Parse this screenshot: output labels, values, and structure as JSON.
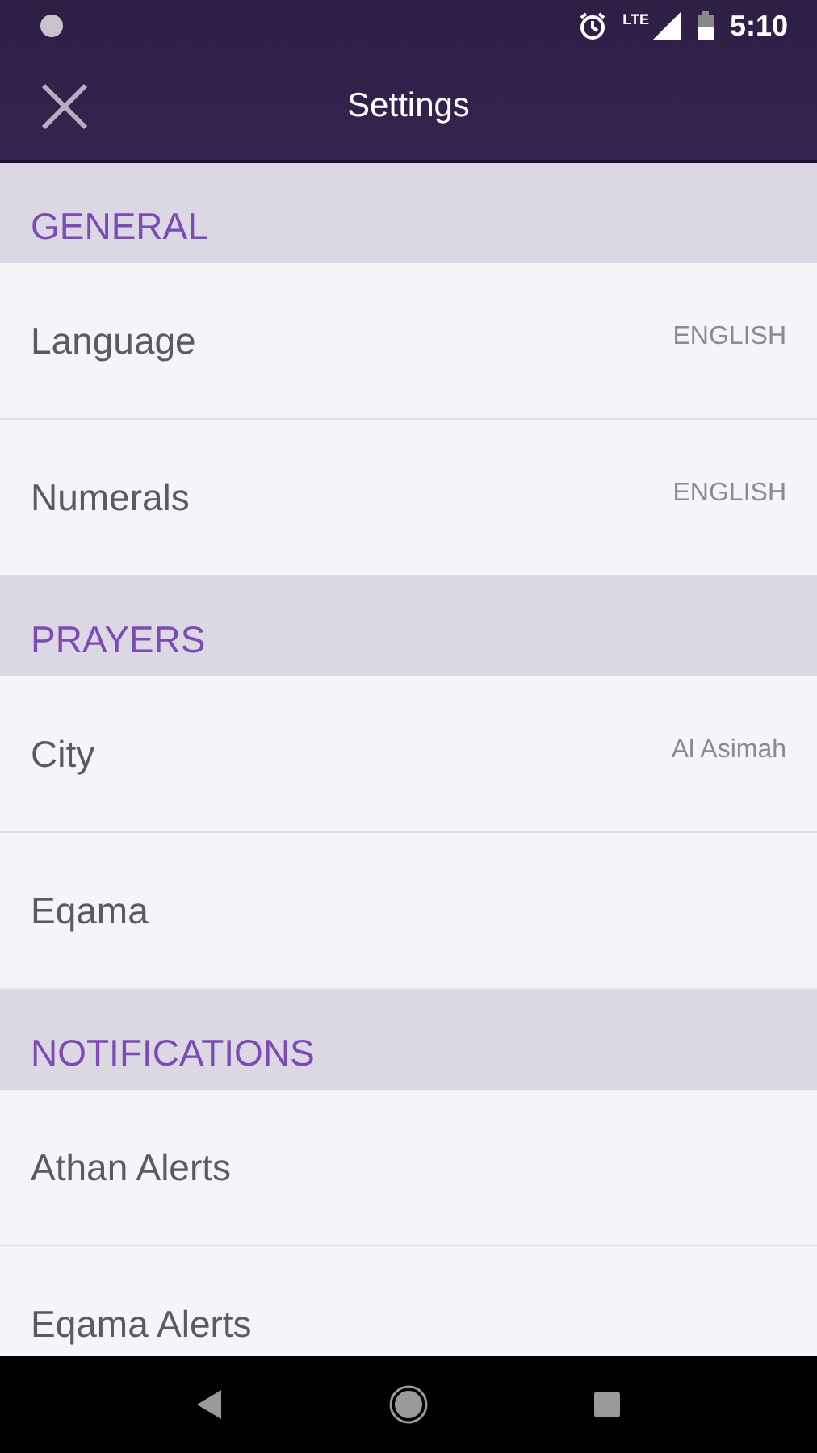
{
  "status_bar": {
    "time": "5:10",
    "network": "LTE"
  },
  "toolbar": {
    "title": "Settings"
  },
  "sections": [
    {
      "title": "GENERAL",
      "items": [
        {
          "label": "Language",
          "value": "ENGLISH"
        },
        {
          "label": "Numerals",
          "value": "ENGLISH"
        }
      ]
    },
    {
      "title": "PRAYERS",
      "items": [
        {
          "label": "City",
          "value": "Al Asimah"
        },
        {
          "label": "Eqama"
        }
      ]
    },
    {
      "title": "NOTIFICATIONS",
      "items": [
        {
          "label": "Athan Alerts"
        },
        {
          "label": "Eqama Alerts"
        }
      ]
    }
  ]
}
